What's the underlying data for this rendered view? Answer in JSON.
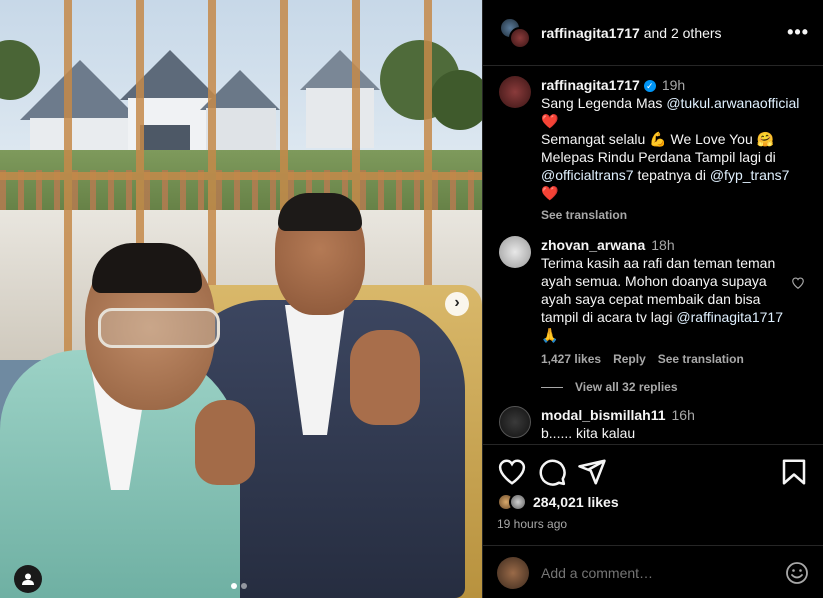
{
  "header": {
    "username": "raffinagita1717",
    "others": "and 2 others"
  },
  "comments": [
    {
      "username": "raffinagita1717",
      "verified": true,
      "time": "19h",
      "lines": [
        {
          "pre": "Sang Legenda Mas ",
          "mention": "@tukul.arwanaofficial",
          "post": ""
        },
        {
          "pre": "❤️",
          "mention": "",
          "post": ""
        },
        {
          "pre": "Semangat selalu 💪 We Love You 🤗",
          "mention": "",
          "post": ""
        },
        {
          "pre": "Melepas Rindu Perdana Tampil lagi di",
          "mention": "",
          "post": ""
        },
        {
          "pre": "",
          "mention": "@officialtrans7",
          "post": " tepatnya di "
        },
        {
          "pre": "❤️",
          "mention": "",
          "post": ""
        }
      ],
      "mention_tail": "@fyp_trans7",
      "see_translation": "See translation"
    },
    {
      "username": "zhovan_arwana",
      "time": "18h",
      "text": "Terima kasih aa rafi dan teman teman ayah semua. Mohon doanya supaya ayah saya cepat membaik dan bisa tampil di acara tv lagi",
      "mention": "@raffinagita1717",
      "tail": " 🙏",
      "likes": "1,427 likes",
      "reply": "Reply",
      "see_translation": "See translation",
      "view_replies": "View all 32 replies"
    },
    {
      "username": "modal_bismillah11",
      "time": "16h",
      "text": "b...... kita kalau"
    }
  ],
  "actions": {
    "likes": "284,021 likes",
    "ago": "19 hours ago"
  },
  "add_comment": {
    "placeholder": "Add a comment…"
  },
  "colors": {
    "accent": "#0095f6",
    "heart": "#ed4956"
  }
}
